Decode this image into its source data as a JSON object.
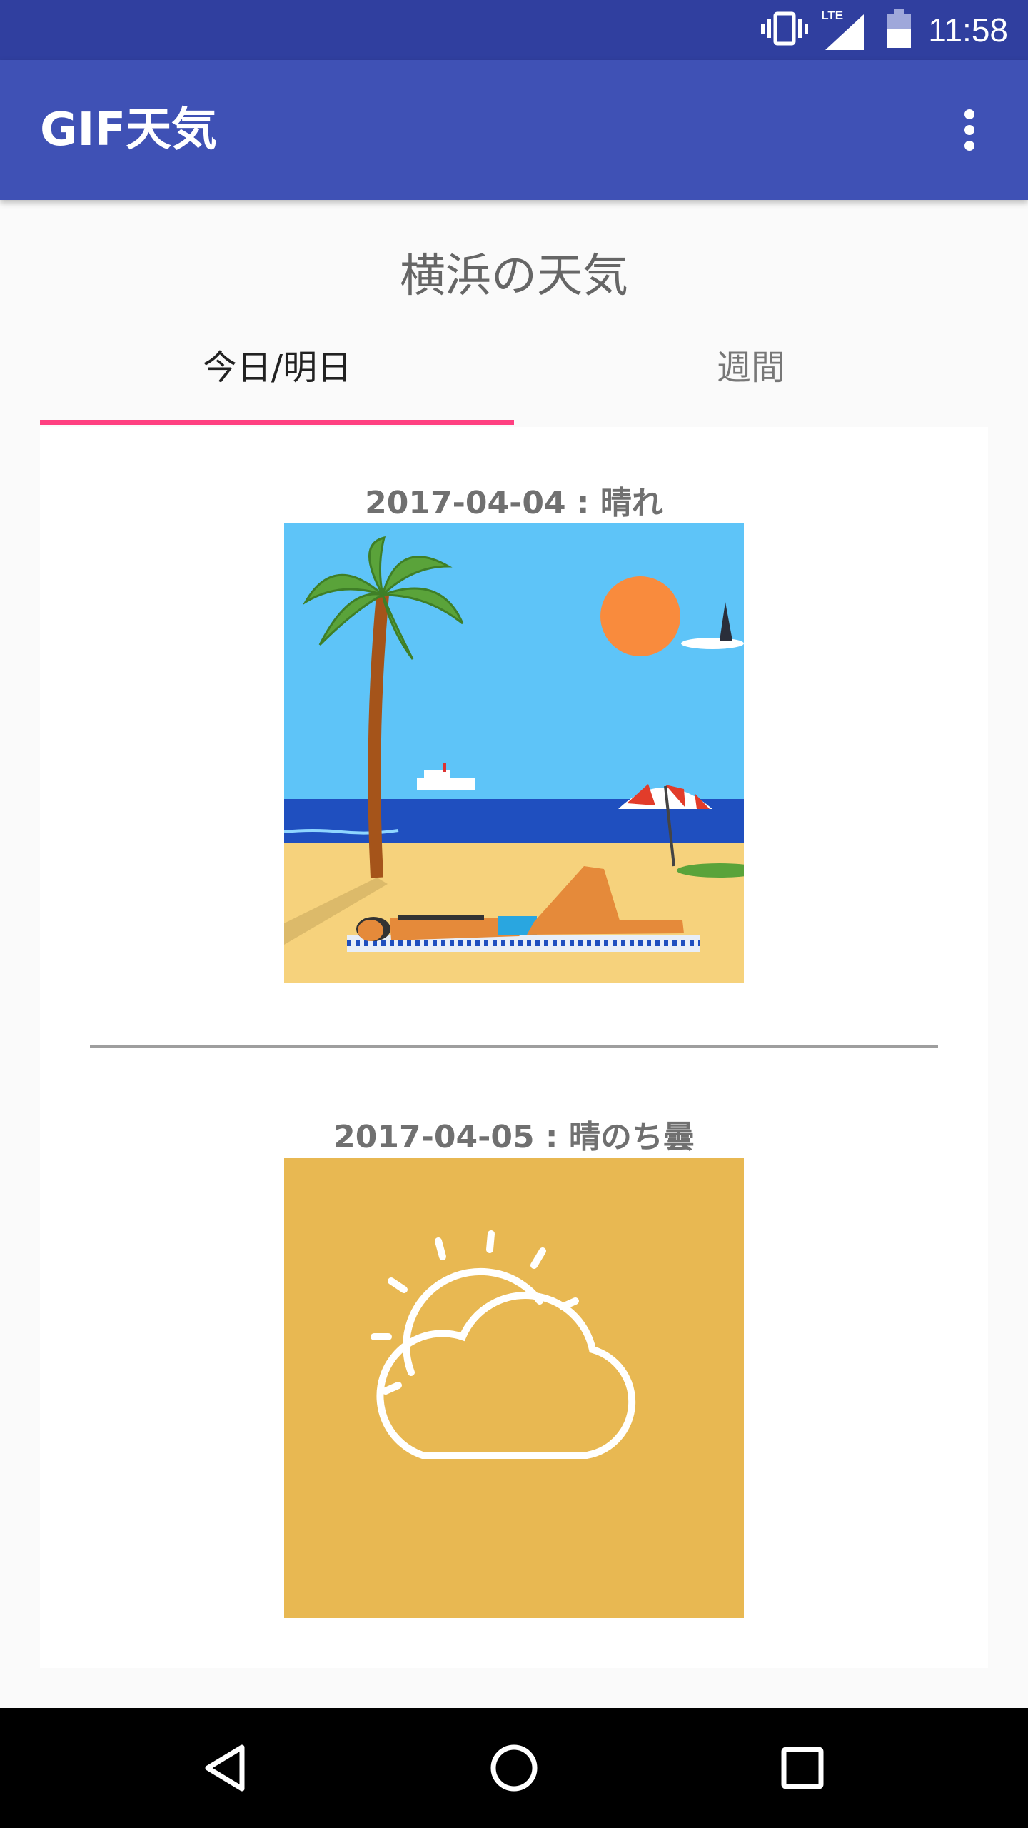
{
  "status_bar": {
    "network": "LTE",
    "time": "11:58"
  },
  "app_bar": {
    "title": "GIF天気",
    "overflow_icon": "more-vert-icon"
  },
  "page": {
    "heading": "横浜の天気"
  },
  "tabs": [
    {
      "label": "今日/明日",
      "selected": true
    },
    {
      "label": "週間",
      "selected": false
    }
  ],
  "forecast": [
    {
      "label": "2017-04-04 : 晴れ",
      "image": "beach-sunny-illustration"
    },
    {
      "label": "2017-04-05 : 晴のち曇",
      "image": "sun-behind-cloud-icon",
      "background": "#e8b852"
    }
  ],
  "nav_bar": {
    "back_icon": "back-triangle-icon",
    "home_icon": "home-circle-icon",
    "recents_icon": "recents-square-icon"
  },
  "colors": {
    "status_bar": "#303f9f",
    "app_bar": "#3f51b5",
    "tab_indicator": "#ff4081",
    "partly_cloudy_bg": "#e8b852"
  }
}
